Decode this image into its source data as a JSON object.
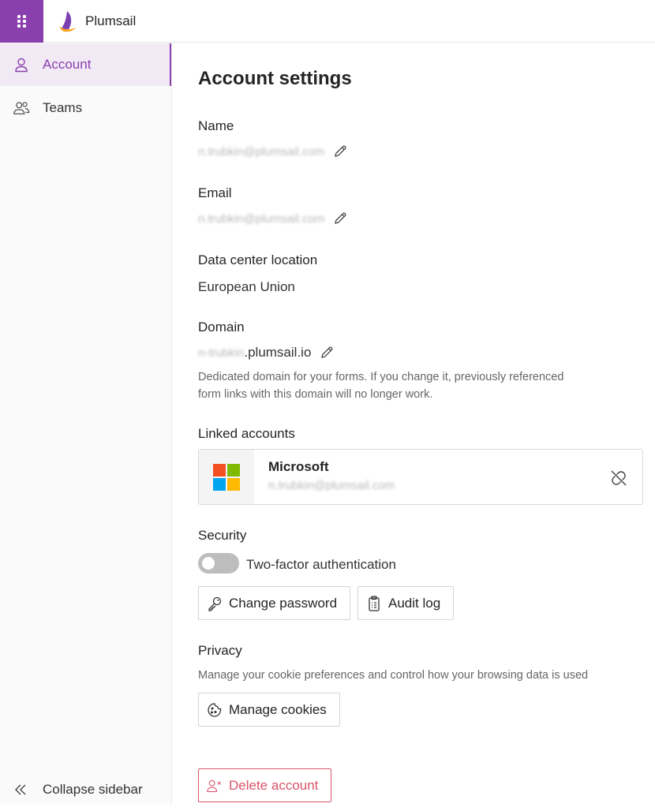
{
  "app": {
    "brand_name": "Plumsail",
    "accent_color": "#8a3fae"
  },
  "sidebar": {
    "items": [
      {
        "label": "Account",
        "icon": "person-icon",
        "active": true
      },
      {
        "label": "Teams",
        "icon": "people-icon",
        "active": false
      }
    ],
    "collapse_label": "Collapse sidebar"
  },
  "main": {
    "title": "Account settings",
    "name": {
      "label": "Name",
      "value": "n.trubkin@plumsail.com"
    },
    "email": {
      "label": "Email",
      "value": "n.trubkin@plumsail.com"
    },
    "data_center": {
      "label": "Data center location",
      "value": "European Union"
    },
    "domain": {
      "label": "Domain",
      "subdomain": "n-trubkin",
      "suffix": ".plumsail.io",
      "helper_line1": "Dedicated domain for your forms. If you change it, previously referenced",
      "helper_line2": "form links with this domain will no longer work."
    },
    "linked_accounts": {
      "label": "Linked accounts",
      "provider": "Microsoft",
      "email": "n.trubkin@plumsail.com"
    },
    "security": {
      "label": "Security",
      "two_factor_label": "Two-factor authentication",
      "two_factor_enabled": false,
      "change_password_label": "Change password",
      "audit_log_label": "Audit log"
    },
    "privacy": {
      "label": "Privacy",
      "description": "Manage your cookie preferences and control how your browsing data is used",
      "manage_cookies_label": "Manage cookies"
    },
    "delete_account_label": "Delete account",
    "danger_color": "#d9546b"
  }
}
